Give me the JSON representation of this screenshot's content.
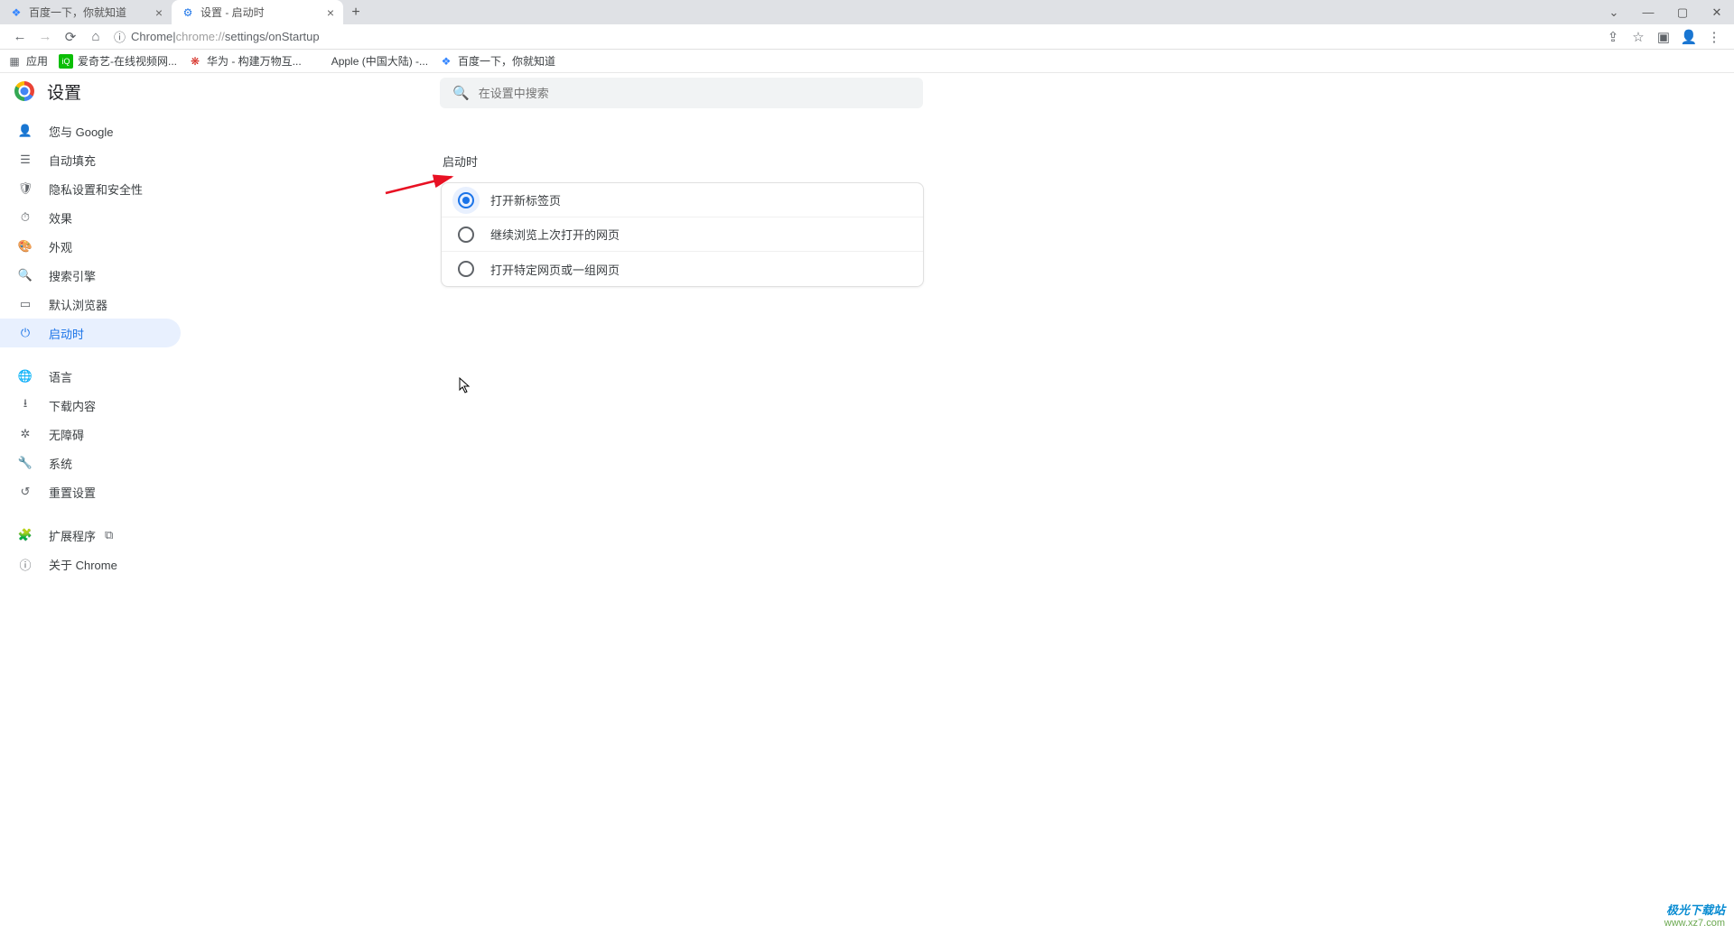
{
  "tabs": [
    {
      "title": "百度一下，你就知道",
      "active": false,
      "favicon_color": "#3385ff"
    },
    {
      "title": "设置 - 启动时",
      "active": true,
      "favicon_color": "#1a73e8"
    }
  ],
  "address": {
    "origin": "Chrome",
    "sep": " | ",
    "url_scheme": "chrome://",
    "url_path": "settings/onStartup"
  },
  "bookmarks": {
    "apps_label": "应用",
    "items": [
      {
        "label": "爱奇艺-在线视频网...",
        "color": "#0bbe06"
      },
      {
        "label": "华为 - 构建万物互...",
        "color": "#d4261c"
      },
      {
        "label": "Apple (中国大陆) -...",
        "color": "#555"
      },
      {
        "label": "百度一下，你就知道",
        "color": "#3385ff"
      }
    ]
  },
  "settings": {
    "title": "设置",
    "search_placeholder": "在设置中搜索",
    "section_title": "启动时",
    "nav": [
      {
        "key": "you-google",
        "icon": "person",
        "label": "您与 Google"
      },
      {
        "key": "autofill",
        "icon": "form",
        "label": "自动填充"
      },
      {
        "key": "privacy",
        "icon": "shield",
        "label": "隐私设置和安全性"
      },
      {
        "key": "performance",
        "icon": "speed",
        "label": "效果"
      },
      {
        "key": "appearance",
        "icon": "palette",
        "label": "外观"
      },
      {
        "key": "search-engine",
        "icon": "search",
        "label": "搜索引擎"
      },
      {
        "key": "default-browser",
        "icon": "browser",
        "label": "默认浏览器"
      },
      {
        "key": "on-startup",
        "icon": "power",
        "label": "启动时",
        "active": true
      }
    ],
    "nav2": [
      {
        "key": "language",
        "icon": "globe",
        "label": "语言"
      },
      {
        "key": "downloads",
        "icon": "download",
        "label": "下载内容"
      },
      {
        "key": "accessibility",
        "icon": "access",
        "label": "无障碍"
      },
      {
        "key": "system",
        "icon": "wrench",
        "label": "系统"
      },
      {
        "key": "reset",
        "icon": "restore",
        "label": "重置设置"
      }
    ],
    "nav3": [
      {
        "key": "extensions",
        "icon": "puzzle",
        "label": "扩展程序",
        "external": true
      },
      {
        "key": "about",
        "icon": "info",
        "label": "关于 Chrome"
      }
    ],
    "options": [
      {
        "label": "打开新标签页",
        "checked": true
      },
      {
        "label": "继续浏览上次打开的网页",
        "checked": false
      },
      {
        "label": "打开特定网页或一组网页",
        "checked": false
      }
    ]
  },
  "watermark": {
    "line1": "极光下载站",
    "line2": "www.xz7.com"
  }
}
